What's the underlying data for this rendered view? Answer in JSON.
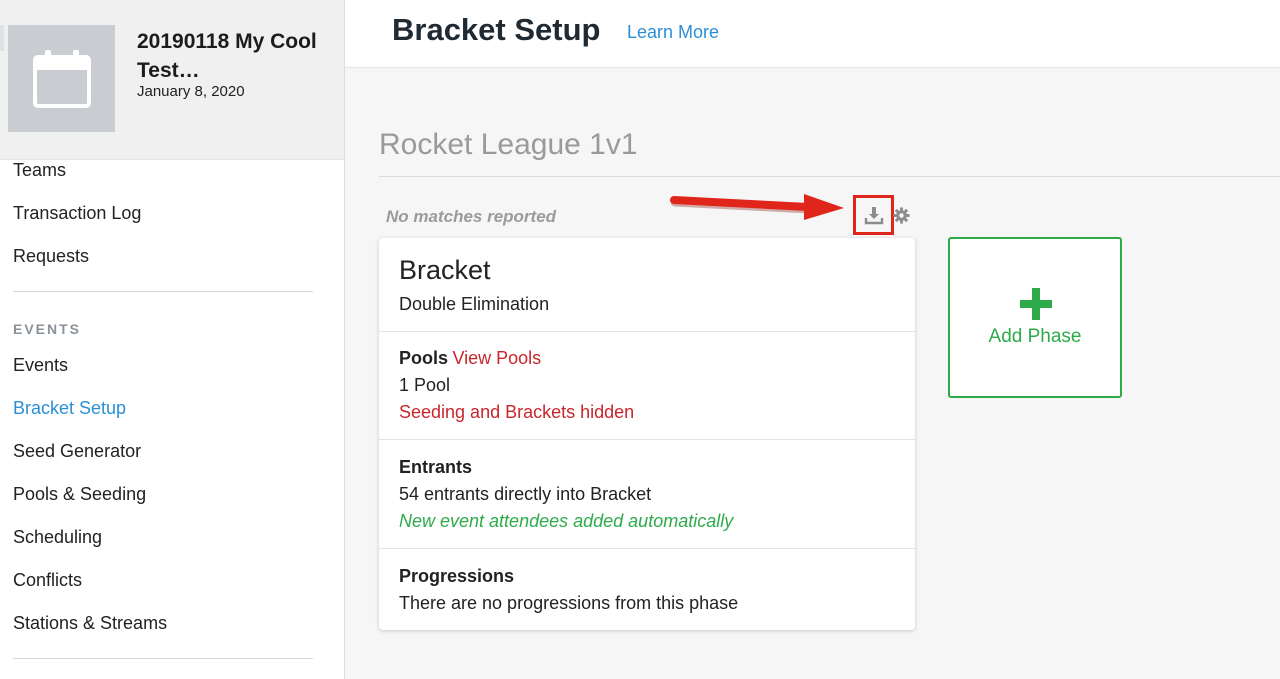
{
  "event": {
    "title": "20190118 My Cool Test…",
    "date": "January 8, 2020"
  },
  "sidebar": {
    "items_top": [
      {
        "label": "Teams"
      },
      {
        "label": "Transaction Log"
      },
      {
        "label": "Requests"
      }
    ],
    "section_label": "EVENTS",
    "items": [
      {
        "label": "Events",
        "active": false
      },
      {
        "label": "Bracket Setup",
        "active": true
      },
      {
        "label": "Seed Generator",
        "active": false
      },
      {
        "label": "Pools & Seeding",
        "active": false
      },
      {
        "label": "Scheduling",
        "active": false
      },
      {
        "label": "Conflicts",
        "active": false
      },
      {
        "label": "Stations & Streams",
        "active": false
      }
    ]
  },
  "header": {
    "title": "Bracket Setup",
    "learn_more": "Learn More"
  },
  "main": {
    "event_name": "Rocket League 1v1",
    "status": "No matches reported",
    "download_icon": "download-icon",
    "settings_icon": "gear-icon",
    "phase": {
      "title": "Bracket",
      "type": "Double Elimination",
      "pools": {
        "label": "Pools",
        "link": "View Pools",
        "count": "1 Pool",
        "note": "Seeding and Brackets hidden"
      },
      "entrants": {
        "label": "Entrants",
        "count": "54 entrants directly into Bracket",
        "note": "New event attendees added automatically"
      },
      "progressions": {
        "label": "Progressions",
        "text": "There are no progressions from this phase"
      }
    },
    "add_phase": "Add Phase"
  },
  "colors": {
    "accent_blue": "#2b8fd6",
    "green": "#2eaa4a",
    "red": "#c9262c",
    "annotation_red": "#e0251b"
  }
}
